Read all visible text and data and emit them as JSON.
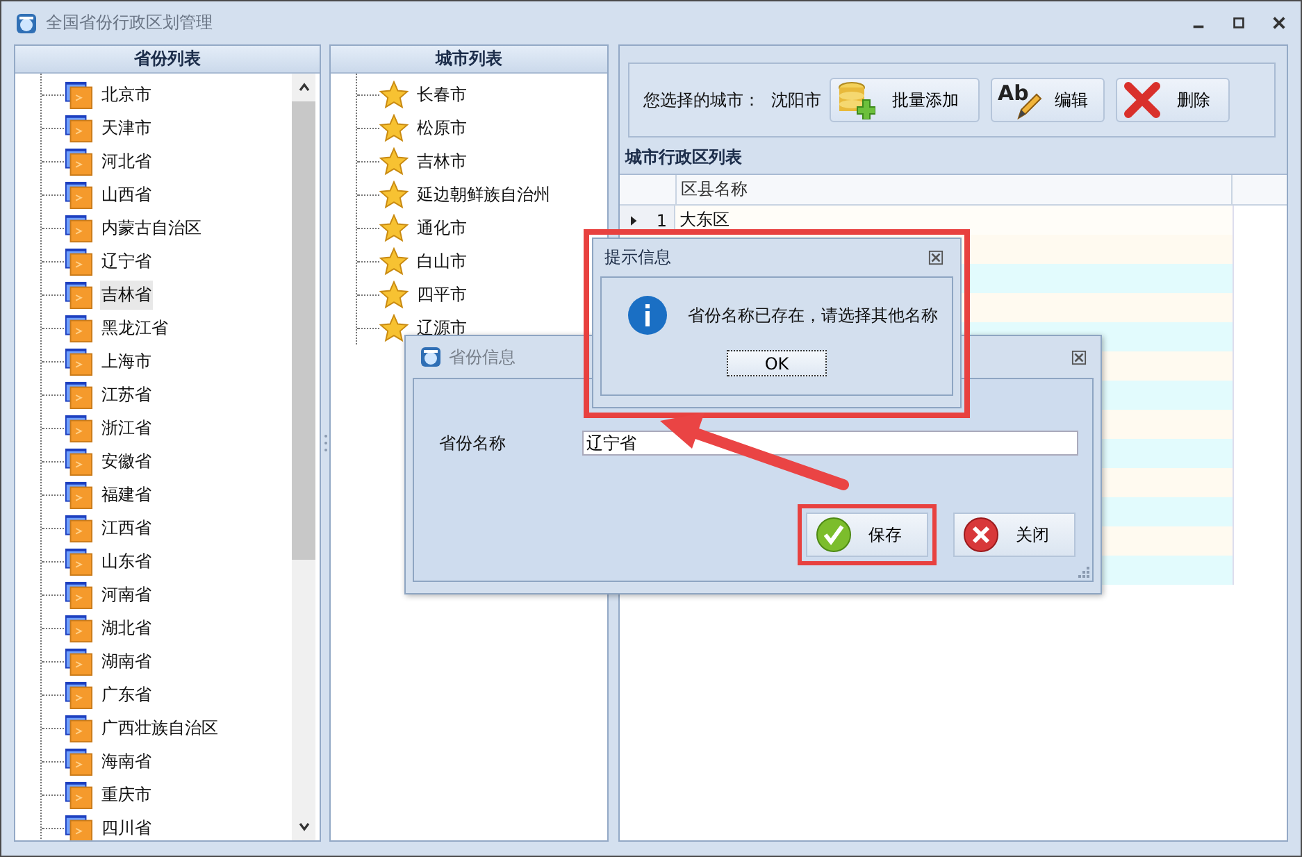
{
  "window": {
    "title": "全国省份行政区划管理"
  },
  "province_panel": {
    "title": "省份列表",
    "items": [
      {
        "label": "北京市",
        "selected": false
      },
      {
        "label": "天津市",
        "selected": false
      },
      {
        "label": "河北省",
        "selected": false
      },
      {
        "label": "山西省",
        "selected": false
      },
      {
        "label": "内蒙古自治区",
        "selected": false
      },
      {
        "label": "辽宁省",
        "selected": false
      },
      {
        "label": "吉林省",
        "selected": true
      },
      {
        "label": "黑龙江省",
        "selected": false
      },
      {
        "label": "上海市",
        "selected": false
      },
      {
        "label": "江苏省",
        "selected": false
      },
      {
        "label": "浙江省",
        "selected": false
      },
      {
        "label": "安徽省",
        "selected": false
      },
      {
        "label": "福建省",
        "selected": false
      },
      {
        "label": "江西省",
        "selected": false
      },
      {
        "label": "山东省",
        "selected": false
      },
      {
        "label": "河南省",
        "selected": false
      },
      {
        "label": "湖北省",
        "selected": false
      },
      {
        "label": "湖南省",
        "selected": false
      },
      {
        "label": "广东省",
        "selected": false
      },
      {
        "label": "广西壮族自治区",
        "selected": false
      },
      {
        "label": "海南省",
        "selected": false
      },
      {
        "label": "重庆市",
        "selected": false
      },
      {
        "label": "四川省",
        "selected": false
      }
    ]
  },
  "city_panel": {
    "title": "城市列表",
    "items": [
      {
        "label": "长春市"
      },
      {
        "label": "松原市"
      },
      {
        "label": "吉林市"
      },
      {
        "label": "延边朝鲜族自治州"
      },
      {
        "label": "通化市"
      },
      {
        "label": "白山市"
      },
      {
        "label": "四平市"
      },
      {
        "label": "辽源市"
      }
    ]
  },
  "toolbar": {
    "city_label": "您选择的城市：",
    "city": "沈阳市",
    "buttons": [
      {
        "kind": "add",
        "label": "批量添加"
      },
      {
        "kind": "edit",
        "label": "编辑",
        "icon_text": "Ab"
      },
      {
        "kind": "delete",
        "label": "删除"
      }
    ]
  },
  "grid": {
    "title": "城市行政区列表",
    "columns": [
      "区县名称"
    ],
    "rows": [
      {
        "number": "1",
        "name": "大东区",
        "current": true
      }
    ]
  },
  "province_dialog": {
    "title": "省份信息",
    "field_label": "省份名称",
    "field_value": "辽宁省",
    "buttons": [
      {
        "kind": "save",
        "label": "保存",
        "highlighted": true
      },
      {
        "kind": "close",
        "label": "关闭",
        "highlighted": false
      }
    ]
  },
  "message_dialog": {
    "title": "提示信息",
    "message": "省份名称已存在，请选择其他名称",
    "button": "OK",
    "highlighted": true
  }
}
